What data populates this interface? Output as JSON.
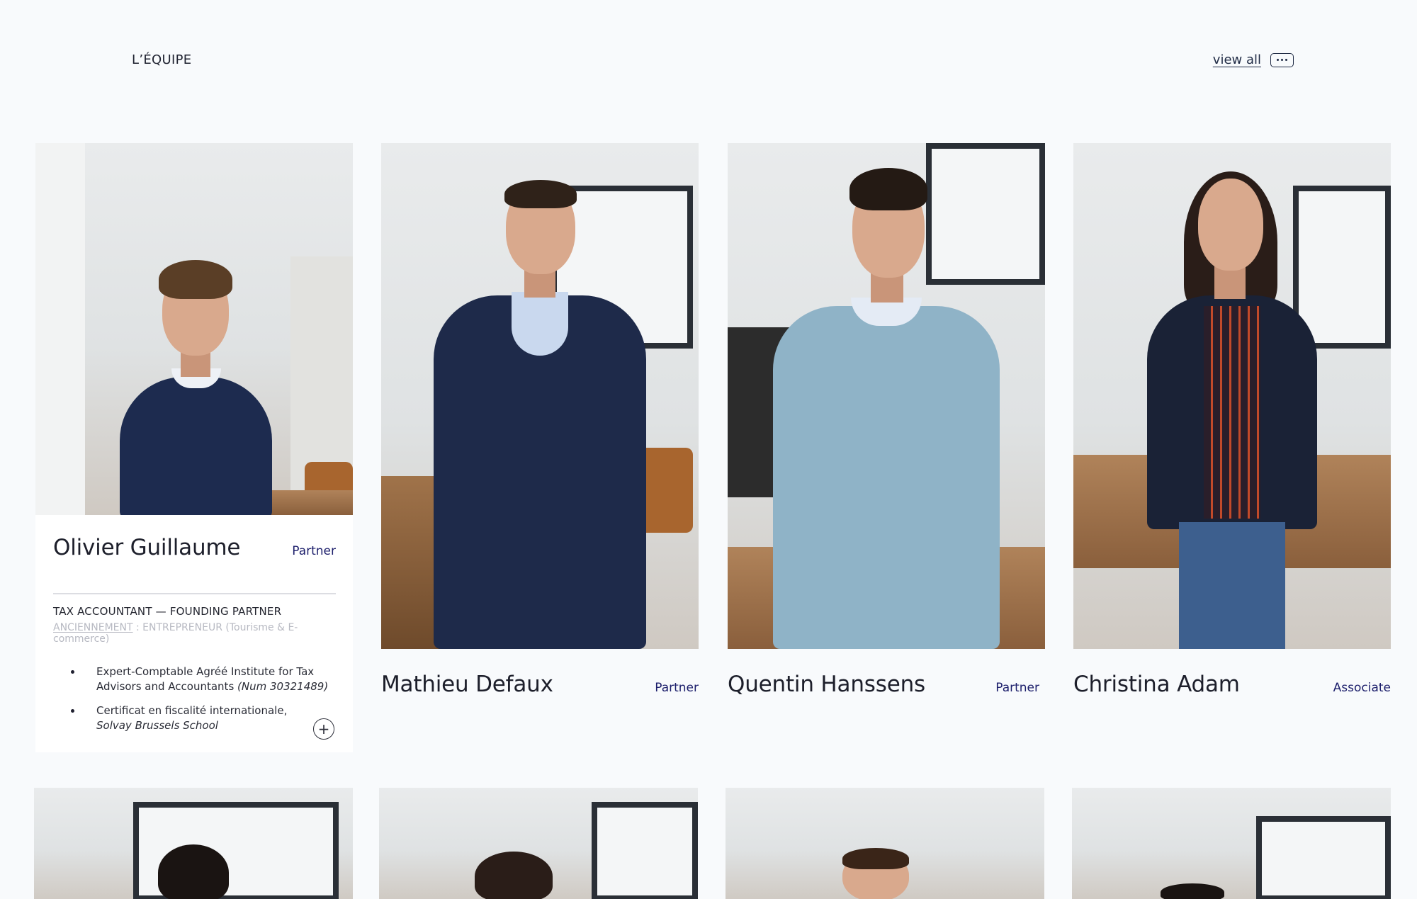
{
  "header": {
    "section_title": "L’ÉQUIPE",
    "view_all_label": "view all",
    "view_all_icon": "more-dots-icon"
  },
  "team": [
    {
      "name": "Olivier Guillaume",
      "role": "Partner",
      "subtitle": "TAX ACCOUNTANT — FOUNDING PARTNER",
      "seniority_label": "ANCIENNEMENT",
      "seniority_value": " : ENTREPRENEUR (Tourisme & E-commerce)",
      "bullets": [
        {
          "text": "Expert-Comptable Agréé Institute for Tax Advisors and Accountants ",
          "italic": "(Num 30321489)"
        },
        {
          "text": "Certificat en fiscalité internationale, ",
          "italic": "Solvay Brussels School"
        }
      ],
      "expand_icon": "plus-icon"
    },
    {
      "name": "Mathieu Defaux",
      "role": "Partner"
    },
    {
      "name": "Quentin Hanssens",
      "role": "Partner"
    },
    {
      "name": "Christina Adam",
      "role": "Associate"
    }
  ],
  "colors": {
    "background": "#f8fafc",
    "role_text": "#1c1e6b",
    "name_text": "#1d1f2b"
  }
}
